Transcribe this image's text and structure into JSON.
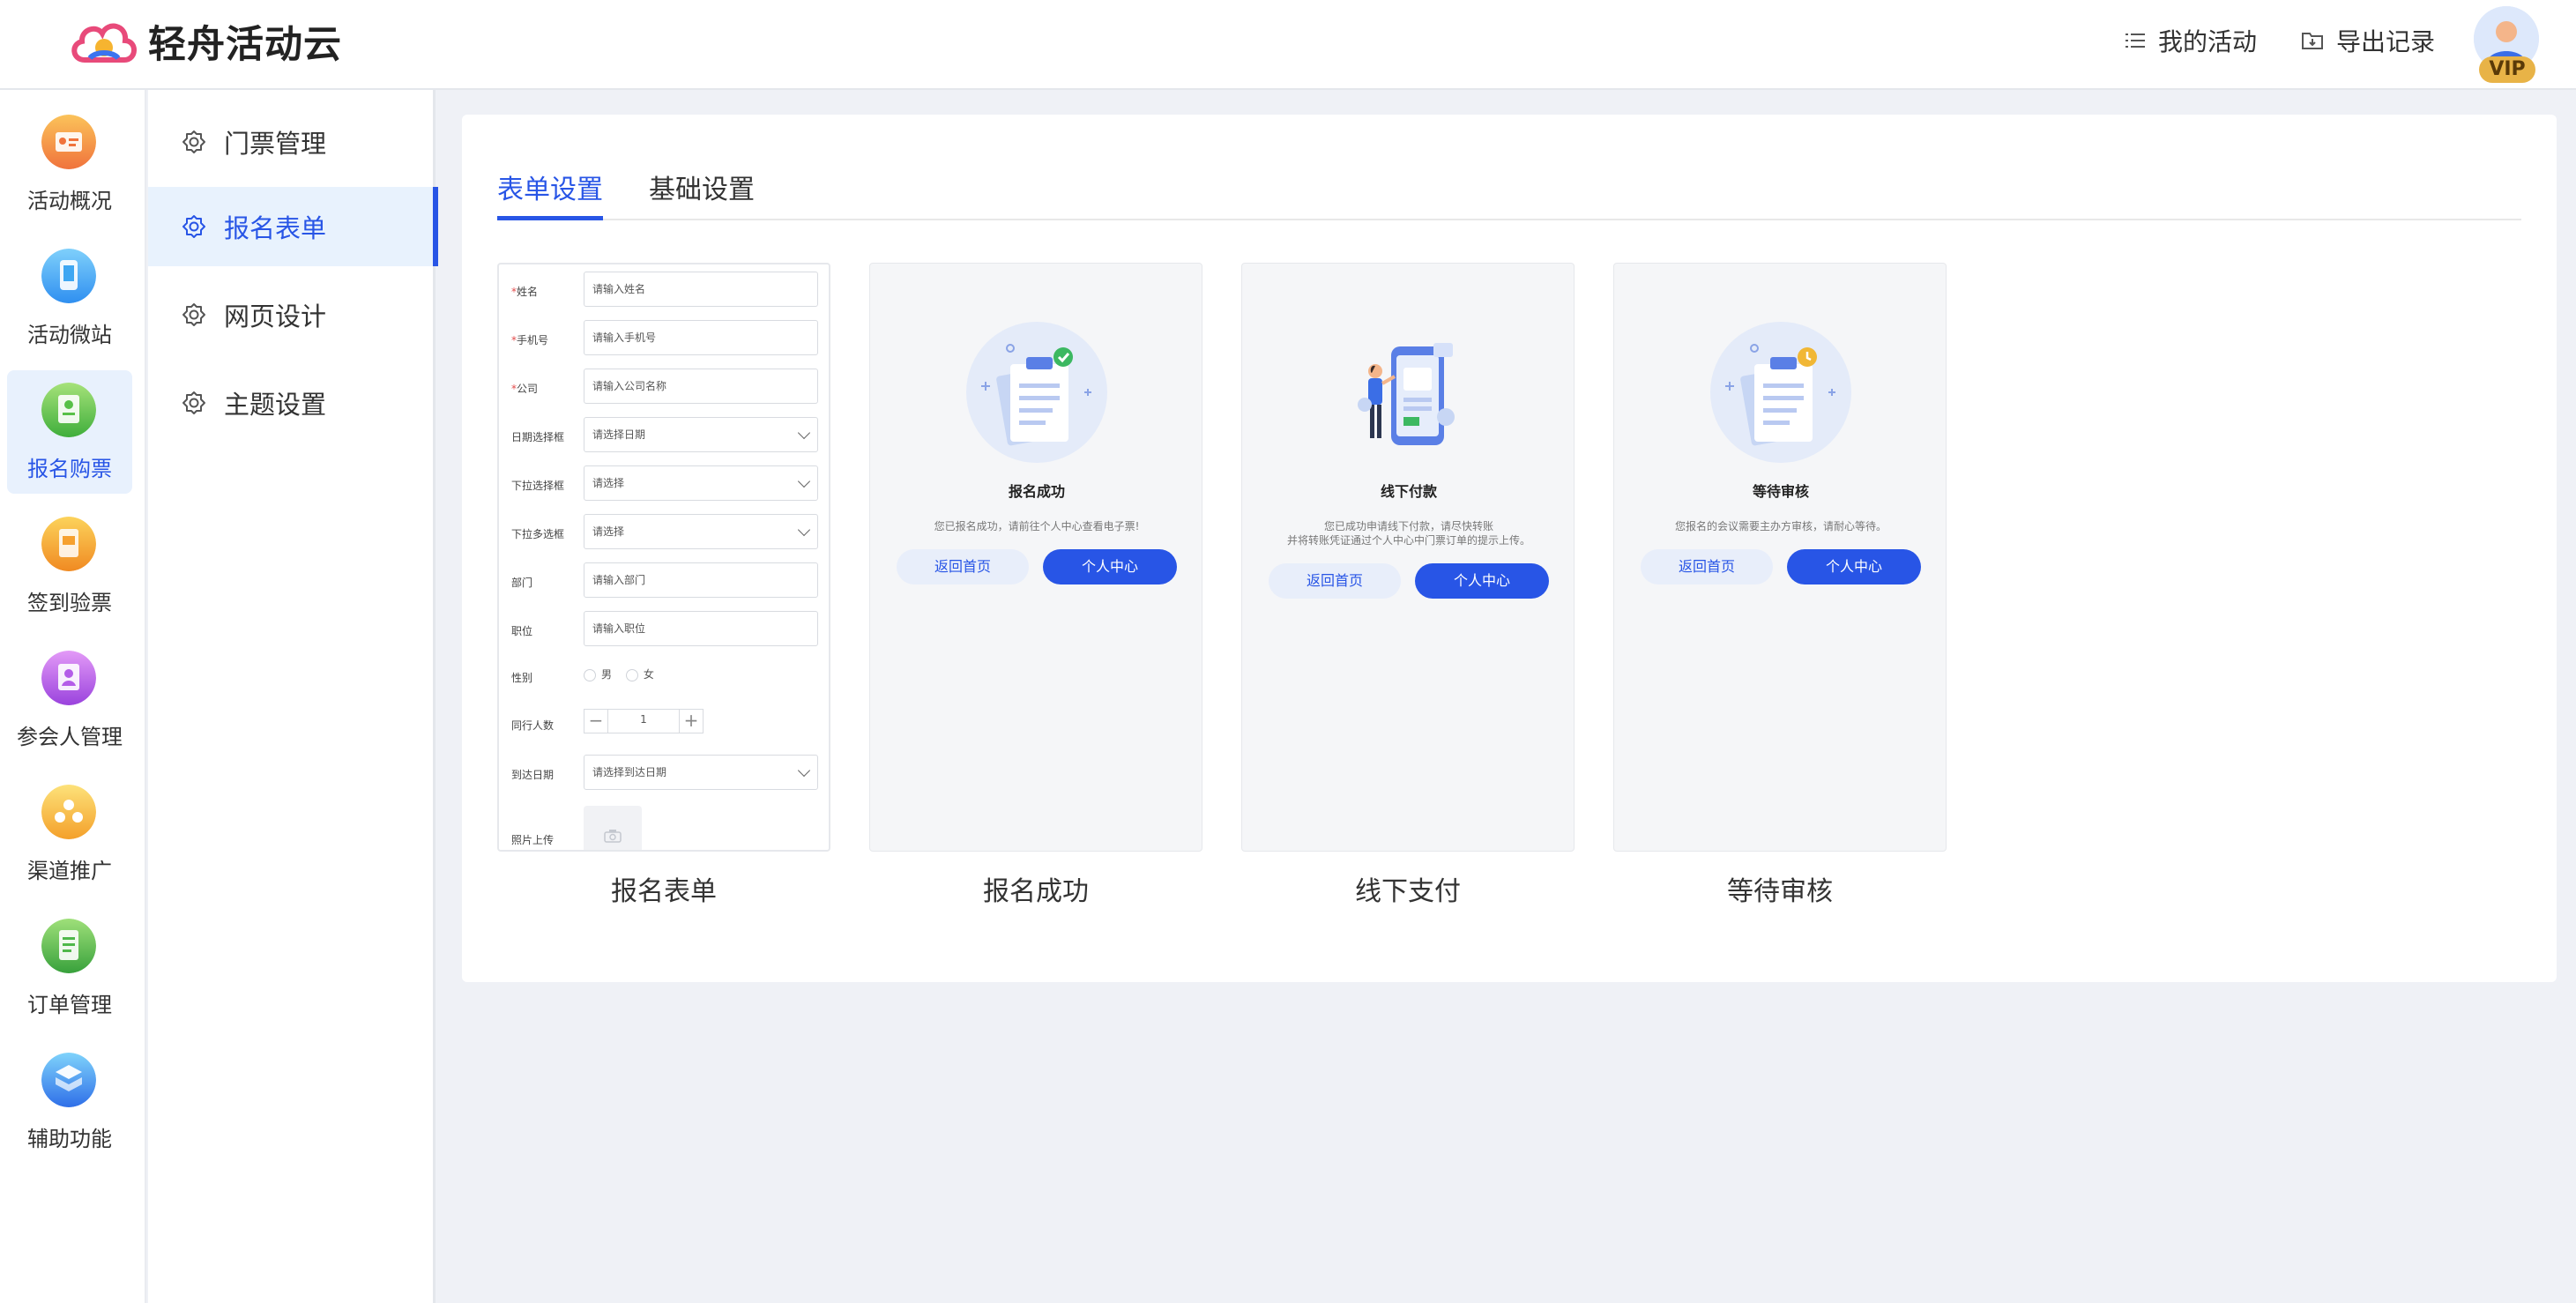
{
  "header": {
    "brand": "轻舟活动云",
    "nav_my_activity": "我的活动",
    "nav_export": "导出记录",
    "vip_badge": "VIP"
  },
  "rail": {
    "items": [
      {
        "label": "活动概况",
        "icon": "dashboard-card-icon",
        "color": "#f0733c",
        "active": false
      },
      {
        "label": "活动微站",
        "icon": "mobile-site-icon",
        "color": "#3ea7f2",
        "active": false
      },
      {
        "label": "报名购票",
        "icon": "ticket-form-icon",
        "color": "#58c048",
        "active": true
      },
      {
        "label": "签到验票",
        "icon": "checkin-icon",
        "color": "#f6a12e",
        "active": false
      },
      {
        "label": "参会人管理",
        "icon": "attendee-icon",
        "color": "#b45de8",
        "active": false
      },
      {
        "label": "渠道推广",
        "icon": "channel-icon",
        "color": "#f7b538",
        "active": false
      },
      {
        "label": "订单管理",
        "icon": "order-icon",
        "color": "#4fb84a",
        "active": false
      },
      {
        "label": "辅助功能",
        "icon": "toolbox-icon",
        "color": "#3b8ff0",
        "active": false
      }
    ]
  },
  "subnav": {
    "items": [
      {
        "label": "门票管理",
        "active": false
      },
      {
        "label": "报名表单",
        "active": true
      },
      {
        "label": "网页设计",
        "active": false
      },
      {
        "label": "主题设置",
        "active": false
      }
    ]
  },
  "tabs": [
    {
      "label": "表单设置",
      "active": true
    },
    {
      "label": "基础设置",
      "active": false
    }
  ],
  "form_preview": {
    "fields": [
      {
        "label": "姓名",
        "required": true,
        "type": "input",
        "placeholder": "请输入姓名"
      },
      {
        "label": "手机号",
        "required": true,
        "type": "input",
        "placeholder": "请输入手机号"
      },
      {
        "label": "公司",
        "required": true,
        "type": "input",
        "placeholder": "请输入公司名称"
      },
      {
        "label": "日期选择框",
        "required": false,
        "type": "select",
        "placeholder": "请选择日期"
      },
      {
        "label": "下拉选择框",
        "required": false,
        "type": "select",
        "placeholder": "请选择"
      },
      {
        "label": "下拉多选框",
        "required": false,
        "type": "select",
        "placeholder": "请选择"
      },
      {
        "label": "部门",
        "required": false,
        "type": "input",
        "placeholder": "请输入部门"
      },
      {
        "label": "职位",
        "required": false,
        "type": "input",
        "placeholder": "请输入职位"
      }
    ],
    "gender": {
      "label": "性别",
      "options": [
        "男",
        "女"
      ]
    },
    "companions": {
      "label": "同行人数",
      "value": "1"
    },
    "arrival": {
      "label": "到达日期",
      "placeholder": "请选择到达日期"
    },
    "photo": {
      "label": "照片上传"
    }
  },
  "cards": [
    {
      "caption": "报名表单"
    },
    {
      "caption": "报名成功",
      "title": "报名成功",
      "desc": [
        "您已报名成功，请前往个人中心查看电子票!"
      ],
      "btn_left": "返回首页",
      "btn_right": "个人中心",
      "status_color": "#3cb861"
    },
    {
      "caption": "线下支付",
      "title": "线下付款",
      "desc": [
        "您已成功申请线下付款，请尽快转账",
        "并将转账凭证通过个人中心中门票订单的提示上传。"
      ],
      "btn_left": "返回首页",
      "btn_right": "个人中心"
    },
    {
      "caption": "等待审核",
      "title": "等待审核",
      "desc": [
        "您报名的会议需要主办方审核，请耐心等待。"
      ],
      "btn_left": "返回首页",
      "btn_right": "个人中心",
      "status_color": "#f1b735"
    }
  ],
  "colors": {
    "accent": "#2855e6",
    "active_bg": "#e8f2fd",
    "page_bg": "#eff1f6"
  }
}
